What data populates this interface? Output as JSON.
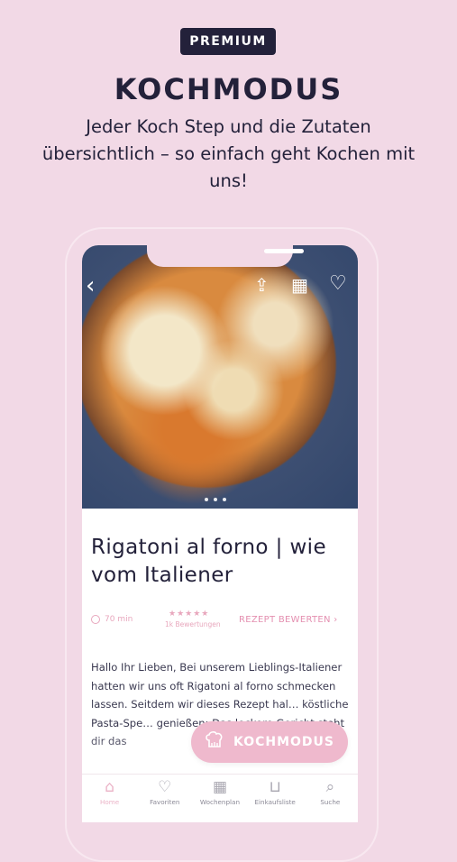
{
  "promo": {
    "badge": "PREMIUM",
    "headline": "KOCHMODUS",
    "subline": "Jeder Koch Step und die Zutaten übersichtlich – so einfach geht Kochen mit uns!"
  },
  "recipe": {
    "title": "Rigatoni al forno | wie vom Italiener",
    "time": "70 min",
    "stars_display": "★★★★★",
    "rating_count": "1k Bewertungen",
    "rate_link": "REZEPT BEWERTEN",
    "description": "Hallo Ihr Lieben, Bei unserem Lieblings-Italiener hatten wir uns oft Rigatoni al forno schmecken lassen. Seitdem wir dieses Rezept hal… köstliche Pasta-Spe… genießen: Das leckere Gericht steht dir das"
  },
  "photo_controls": {
    "back": "‹",
    "share": "⇪",
    "calendar": "▦",
    "favorite": "♡"
  },
  "cta": {
    "label": "KOCHMODUS",
    "icon": "chef-hat-icon"
  },
  "tabbar": {
    "items": [
      {
        "label": "Home",
        "icon": "home-icon",
        "active": true
      },
      {
        "label": "Favoriten",
        "icon": "heart-icon",
        "active": false
      },
      {
        "label": "Wochenplan",
        "icon": "calendar-icon",
        "active": false
      },
      {
        "label": "Einkaufsliste",
        "icon": "basket-icon",
        "active": false
      },
      {
        "label": "Suche",
        "icon": "search-icon",
        "active": false
      }
    ]
  },
  "colors": {
    "background": "#f2d9e6",
    "navy": "#23213a",
    "accent_pink": "#efb9cd"
  }
}
